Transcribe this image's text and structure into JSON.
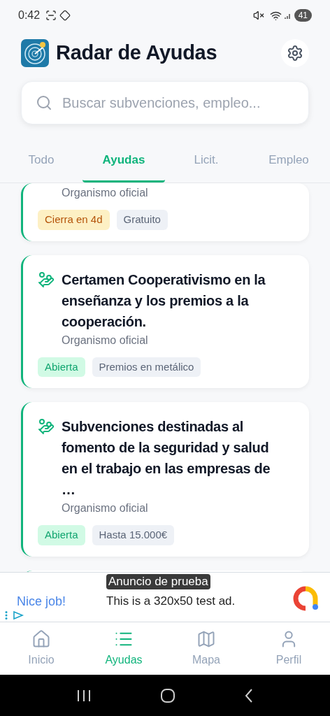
{
  "status_bar": {
    "time": "0:42",
    "battery": "41"
  },
  "header": {
    "title": "Radar de Ayudas"
  },
  "search": {
    "placeholder": "Buscar subvenciones, empleo..."
  },
  "tabs": [
    {
      "label": "Todo",
      "selected": false
    },
    {
      "label": "Ayudas",
      "selected": true
    },
    {
      "label": "Licit.",
      "selected": false
    },
    {
      "label": "Empleo",
      "selected": false
    }
  ],
  "cards": [
    {
      "subtitle": "Organismo oficial",
      "tags": [
        {
          "label": "Cierra en 4d",
          "kind": "deadline"
        },
        {
          "label": "Gratuito",
          "kind": "neutral"
        }
      ]
    },
    {
      "title": "Certamen Cooperativismo en la enseñanza y los premios a la cooperación.",
      "subtitle": "Organismo oficial",
      "tags": [
        {
          "label": "Abierta",
          "kind": "open"
        },
        {
          "label": "Premios en metálico",
          "kind": "neutral"
        }
      ]
    },
    {
      "title": "Subvenciones destinadas al fomento de la seguridad y salud en el trabajo en las empresas de …",
      "subtitle": "Organismo oficial",
      "tags": [
        {
          "label": "Abierta",
          "kind": "open"
        },
        {
          "label": "Hasta 15.000€",
          "kind": "neutral"
        }
      ]
    }
  ],
  "ad": {
    "label": "Anuncio de prueba",
    "headline": "Nice job!",
    "text": "This is a 320x50 test ad."
  },
  "bottom_nav": [
    {
      "label": "Inicio",
      "selected": false
    },
    {
      "label": "Ayudas",
      "selected": true
    },
    {
      "label": "Mapa",
      "selected": false
    },
    {
      "label": "Perfil",
      "selected": false
    }
  ]
}
